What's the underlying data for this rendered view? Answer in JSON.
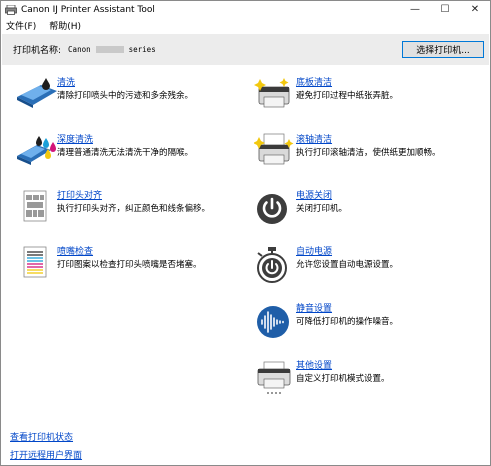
{
  "window": {
    "title": "Canon IJ Printer Assistant Tool",
    "minimize": "—",
    "maximize": "☐",
    "close": "✕"
  },
  "menu": {
    "file": "文件(F)",
    "help": "帮助(H)"
  },
  "printer": {
    "label": "打印机名称:",
    "name_prefix": "Canon",
    "name_suffix": "series",
    "select_button": "选择打印机..."
  },
  "left_items": [
    {
      "title": "清洗",
      "desc": "清除打印喷头中的污迹和多余残余。",
      "icon": "cleaning-icon"
    },
    {
      "title": "深度清洗",
      "desc": "清理普通清洗无法清洗干净的隔喉。",
      "icon": "deep-cleaning-icon"
    },
    {
      "title": "打印头对齐",
      "desc": "执行打印头对齐，纠正颜色和线条偏移。",
      "icon": "print-head-alignment-icon"
    },
    {
      "title": "喷嘴检查",
      "desc": "打印图案以检查打印头喷嘴是否堵塞。",
      "icon": "nozzle-check-icon"
    }
  ],
  "right_items": [
    {
      "title": "底板清洁",
      "desc": "避免打印过程中纸张弄脏。",
      "icon": "bottom-plate-cleaning-icon"
    },
    {
      "title": "滚轴清洁",
      "desc": "执行打印滚轴清洁，使供纸更加顺畅。",
      "icon": "roller-cleaning-icon"
    },
    {
      "title": "电源关闭",
      "desc": "关闭打印机。",
      "icon": "power-off-icon"
    },
    {
      "title": "自动电源",
      "desc": "允许您设置自动电源设置。",
      "icon": "auto-power-icon"
    },
    {
      "title": "静音设置",
      "desc": "可降低打印机的操作噪音。",
      "icon": "quiet-setting-icon"
    },
    {
      "title": "其他设置",
      "desc": "自定义打印机模式设置。",
      "icon": "custom-settings-icon"
    }
  ],
  "footer": {
    "view_status": "查看打印机状态",
    "open_remote_ui": "打开远程用户界面"
  }
}
